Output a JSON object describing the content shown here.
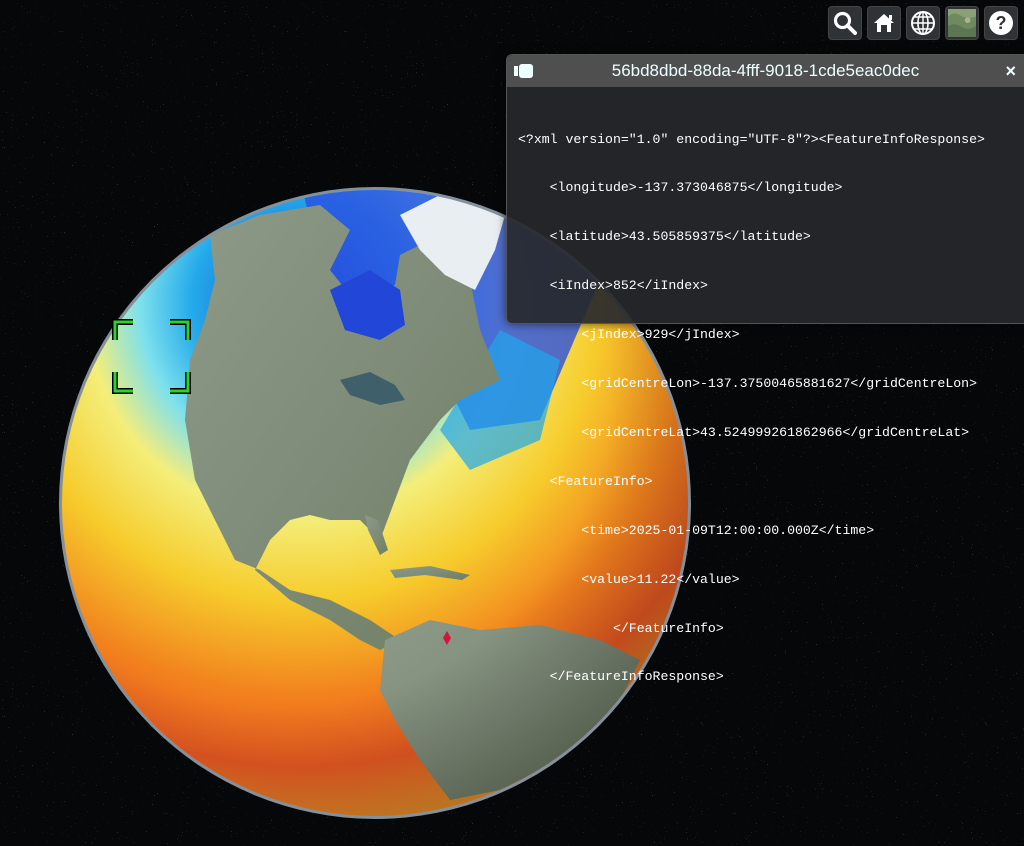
{
  "toolbar": {
    "buttons": [
      {
        "icon": "search-icon"
      },
      {
        "icon": "home-icon"
      },
      {
        "icon": "globe-icon"
      },
      {
        "icon": "base-layer-picker-icon"
      },
      {
        "icon": "help-icon"
      }
    ]
  },
  "infobox": {
    "title": "56bd8dbd-88da-4fff-9018-1cde5eac0dec",
    "close_label": "×",
    "lines": [
      "<?xml version=\"1.0\" encoding=\"UTF-8\"?><FeatureInfoResponse>",
      "    <longitude>-137.373046875</longitude>",
      "    <latitude>43.505859375</latitude>",
      "    <iIndex>852</iIndex>",
      "        <jIndex>929</jIndex>",
      "        <gridCentreLon>-137.37500465881627</gridCentreLon>",
      "        <gridCentreLat>43.524999261862966</gridCentreLat>",
      "    <FeatureInfo>",
      "        <time>2025-01-09T12:00:00.000Z</time>",
      "        <value>11.22</value>",
      "            </FeatureInfo>",
      "    </FeatureInfoResponse>"
    ]
  },
  "globe": {
    "selection_indicator_color": "#2fd12f",
    "marker_color": "#d4143c"
  }
}
